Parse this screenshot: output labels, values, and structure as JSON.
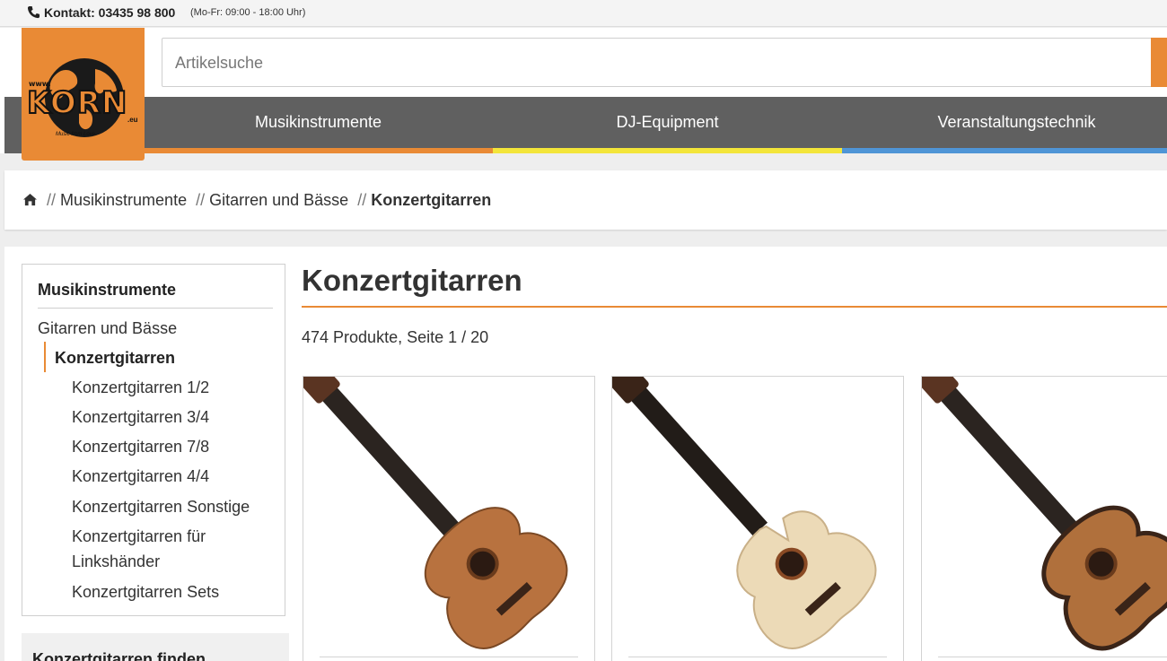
{
  "topbar": {
    "contact_label": "Kontakt: 03435 98 800",
    "hours": "(Mo-Fr: 09:00 - 18:00 Uhr)",
    "icon": "phone-icon"
  },
  "logo": {
    "www": "www.",
    "name": "KORN",
    "tld": ".eu",
    "tagline": "Music from Love"
  },
  "search": {
    "placeholder": "Artikelsuche",
    "value": ""
  },
  "nav": {
    "items": [
      {
        "label": "Musikinstrumente",
        "accent": "#e98a35"
      },
      {
        "label": "DJ-Equipment",
        "accent": "#f3e53a"
      },
      {
        "label": "Veranstaltungstechnik",
        "accent": "#4f95d6"
      }
    ]
  },
  "breadcrumb": {
    "icon": "home-icon",
    "separator": "//",
    "items": [
      "Musikinstrumente",
      "Gitarren und Bässe"
    ],
    "current": "Konzertgitarren"
  },
  "sidebar": {
    "title": "Musikinstrumente",
    "parent": "Gitarren und Bässe",
    "active": "Konzertgitarren",
    "subcategories": [
      "Konzertgitarren 1/2",
      "Konzertgitarren 3/4",
      "Konzertgitarren 7/8",
      "Konzertgitarren 4/4",
      "Konzertgitarren Sonstige",
      "Konzertgitarren für Linkshänder",
      "Konzertgitarren Sets"
    ],
    "filter_title": "Konzertgitarren finden"
  },
  "main": {
    "title": "Konzertgitarren",
    "count": "474 Produkte, Seite 1 / 20"
  },
  "products": [
    {
      "image": "classical-guitar-natural-cedar",
      "body_color": "#b8723f",
      "top_color": "#c98554"
    },
    {
      "image": "classical-guitar-cutaway-spruce",
      "body_color": "#e9d7b4",
      "top_color": "#f1e2c4"
    },
    {
      "image": "classical-guitar-cedar-dark-sides",
      "body_color": "#b0703c",
      "top_color": "#c27e4b"
    }
  ],
  "colors": {
    "accent": "#e98a35",
    "nav_bg": "#606060"
  }
}
